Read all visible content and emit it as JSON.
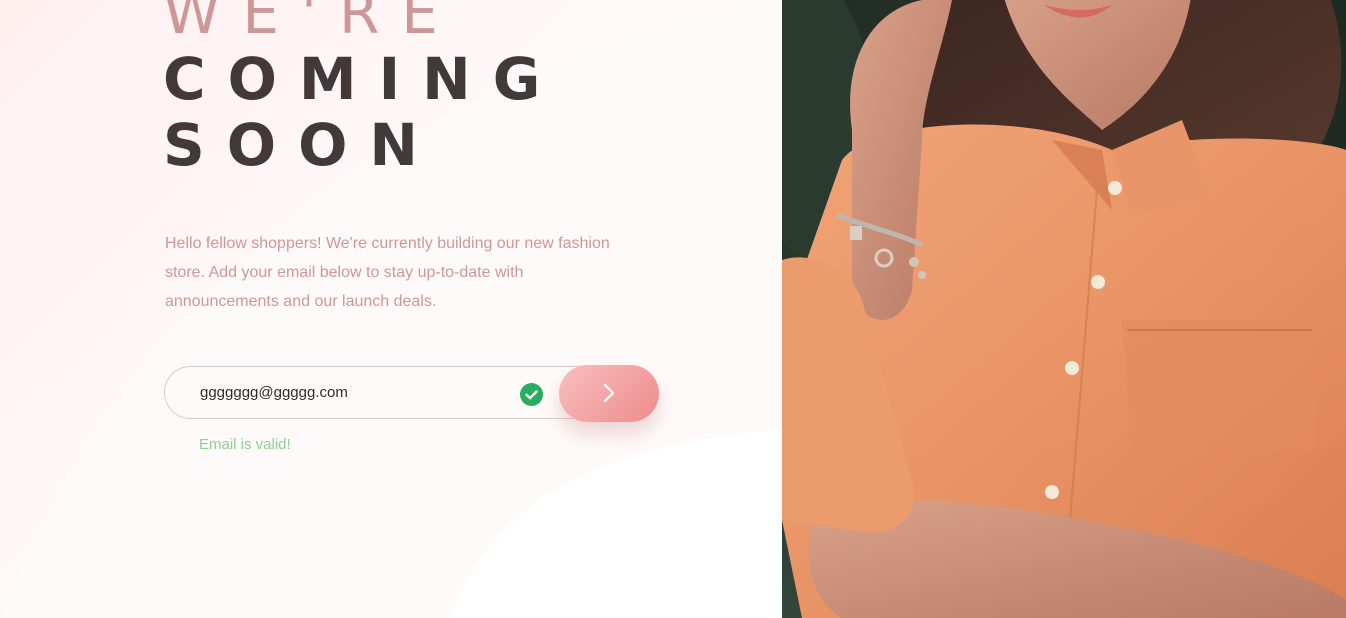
{
  "hero": {
    "headline_light": "We're",
    "headline_line2": "coming",
    "headline_line3": "soon",
    "description": "Hello fellow shoppers! We're currently building our new fashion store. Add your email below to stay up-to-date with announcements and our launch deals."
  },
  "email_form": {
    "email_value": "ggggggg@ggggg.com",
    "validation_message": "Email is valid!",
    "status_icon": "check-circle-icon",
    "submit_icon": "arrow-right-icon"
  },
  "colors": {
    "accent_light": "#ce9797",
    "headline_dark": "#423a3a",
    "success": "#27ae60",
    "success_text": "#8fcf8f",
    "button_gradient_start": "#f8bfbf",
    "button_gradient_end": "#ee8b8b"
  },
  "hero_image": {
    "subject": "woman in orange shirt with charm bracelet"
  }
}
